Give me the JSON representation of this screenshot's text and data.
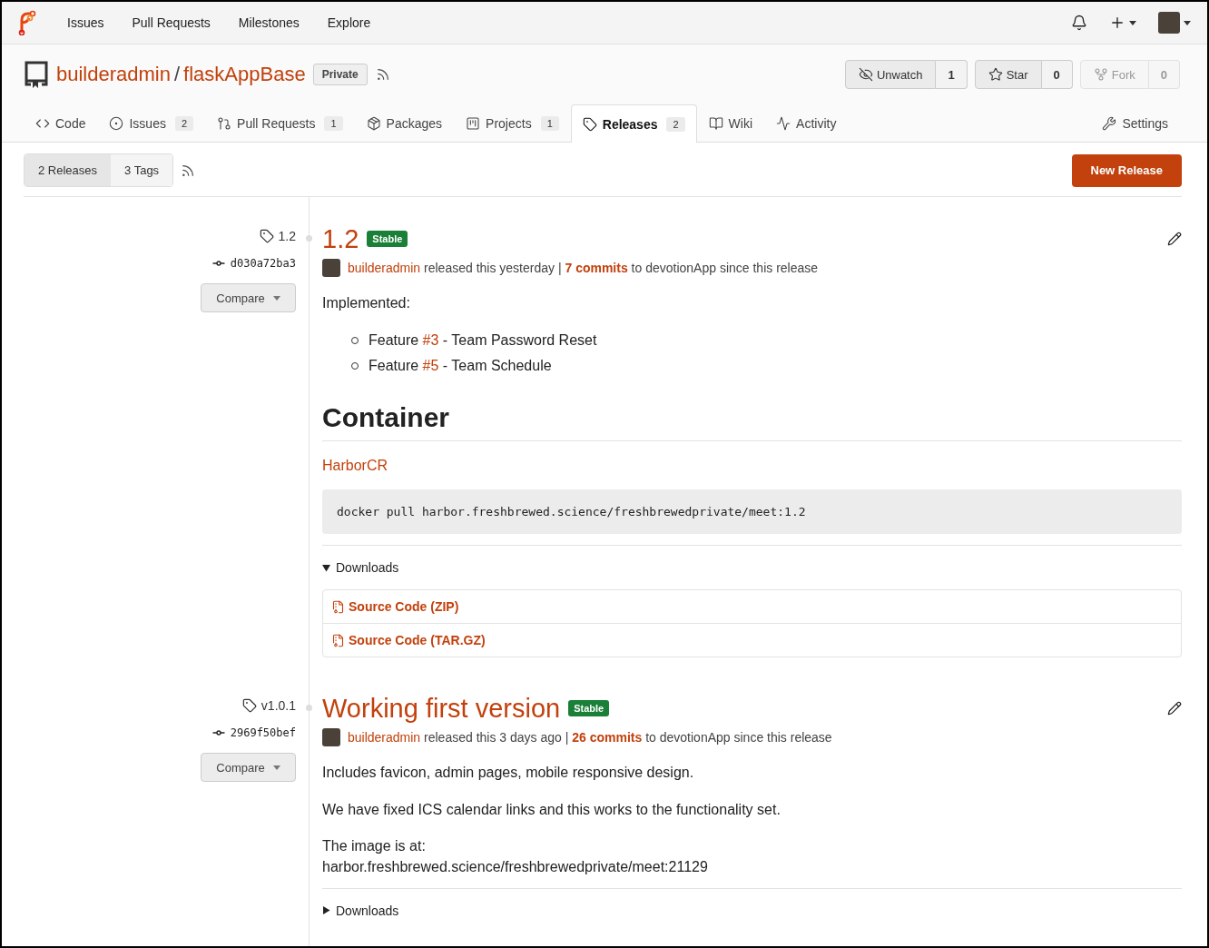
{
  "navbar": {
    "items": [
      "Issues",
      "Pull Requests",
      "Milestones",
      "Explore"
    ]
  },
  "repo": {
    "owner": "builderadmin",
    "separator": "/",
    "name": "flaskAppBase",
    "visibility": "Private",
    "actions": [
      {
        "kind": "watch",
        "label": "Unwatch",
        "count": "1",
        "disabled": false
      },
      {
        "kind": "star",
        "label": "Star",
        "count": "0",
        "disabled": false
      },
      {
        "kind": "fork",
        "label": "Fork",
        "count": "0",
        "disabled": true
      }
    ]
  },
  "tabs": [
    {
      "kind": "code",
      "label": "Code",
      "selected": false
    },
    {
      "kind": "issues",
      "label": "Issues",
      "count": "2",
      "selected": false
    },
    {
      "kind": "pulls",
      "label": "Pull Requests",
      "count": "1",
      "selected": false
    },
    {
      "kind": "packages",
      "label": "Packages",
      "selected": false
    },
    {
      "kind": "projects",
      "label": "Projects",
      "count": "1",
      "selected": false
    },
    {
      "kind": "releases",
      "label": "Releases",
      "count": "2",
      "selected": true
    },
    {
      "kind": "wiki",
      "label": "Wiki",
      "selected": false
    },
    {
      "kind": "activity",
      "label": "Activity",
      "selected": false
    }
  ],
  "settings_tab": {
    "label": "Settings"
  },
  "toolbar": {
    "segments": [
      {
        "label": "2 Releases",
        "selected": true
      },
      {
        "label": "3 Tags",
        "selected": false
      }
    ],
    "new_release_button": "New Release"
  },
  "releases": [
    {
      "tag": "1.2",
      "commit": "d030a72ba3",
      "compare": "Compare",
      "title": "1.2",
      "badge": "Stable",
      "author": "builderadmin",
      "released": "released this yesterday |",
      "commits": "7 commits",
      "since": "to devotionApp since this release",
      "body": [
        {
          "kind": "paragraph",
          "text": "Implemented:"
        },
        {
          "kind": "list",
          "items": [
            {
              "prefix": "Feature",
              "link": "#3",
              "suffix": "- Team Password Reset"
            },
            {
              "prefix": "Feature",
              "link": "#5",
              "suffix": "- Team Schedule"
            }
          ]
        },
        {
          "kind": "heading",
          "text": "Container"
        },
        {
          "kind": "link",
          "text": "HarborCR"
        },
        {
          "kind": "code",
          "text": "docker pull harbor.freshbrewed.science/freshbrewedprivate/meet:1.2"
        }
      ],
      "downloads": {
        "label": "Downloads",
        "expanded": true,
        "files": [
          "Source Code (ZIP)",
          "Source Code (TAR.GZ)"
        ]
      }
    },
    {
      "tag": "v1.0.1",
      "commit": "2969f50bef",
      "compare": "Compare",
      "title": "Working first version",
      "badge": "Stable",
      "author": "builderadmin",
      "released": "released this 3 days ago |",
      "commits": "26 commits",
      "since": "to devotionApp since this release",
      "body": [
        {
          "kind": "paragraph",
          "text": "Includes favicon, admin pages, mobile responsive design."
        },
        {
          "kind": "paragraph",
          "text": "We have fixed ICS calendar links and this works to the functionality set."
        },
        {
          "kind": "paragraph",
          "text": "The image is at:\nharbor.freshbrewed.science/freshbrewedprivate/meet:21129"
        }
      ],
      "downloads": {
        "label": "Downloads",
        "expanded": false
      }
    }
  ]
}
